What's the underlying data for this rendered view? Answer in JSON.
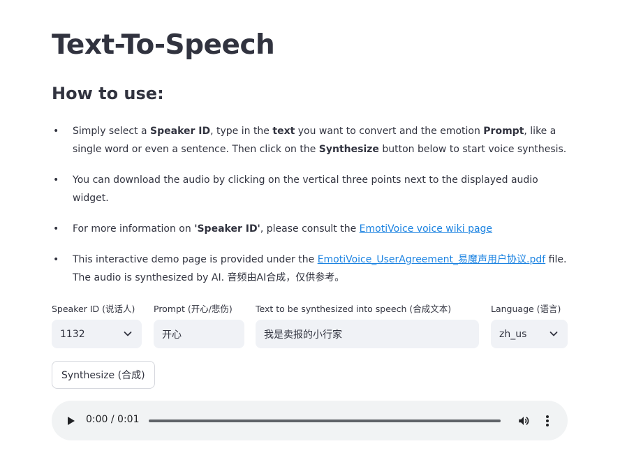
{
  "page": {
    "title": "Text-To-Speech",
    "subtitle": "How to use:"
  },
  "instructions": [
    {
      "a": "Simply select a ",
      "b1": "Speaker ID",
      "c": ", type in the ",
      "b2": "text",
      "d": " you want to convert and the emotion ",
      "b3": "Prompt",
      "e": ", like a single word or even a sentence. Then click on the ",
      "b4": "Synthesize",
      "f": " button below to start voice synthesis."
    },
    {
      "a": "You can download the audio by clicking on the vertical three points next to the displayed audio widget."
    },
    {
      "a": "For more information on ",
      "b1": "'Speaker ID'",
      "c": ", please consult the ",
      "link": "EmotiVoice voice wiki page"
    },
    {
      "a": "This interactive demo page is provided under the ",
      "link": "EmotiVoice_UserAgreement_易魔声用户协议.pdf",
      "c": " file. The audio is synthesized by AI. 音频由AI合成，仅供参考。"
    }
  ],
  "form": {
    "speaker": {
      "label": "Speaker ID (说话人)",
      "value": "1132"
    },
    "prompt": {
      "label": "Prompt (开心/悲伤)",
      "value": "开心"
    },
    "text": {
      "label": "Text to be synthesized into speech (合成文本)",
      "value": "我是卖报的小行家"
    },
    "language": {
      "label": "Language (语言)",
      "value": "zh_us"
    }
  },
  "synthesize_button": "Synthesize (合成)",
  "audio": {
    "time": "0:00 / 0:01",
    "progress": 0
  },
  "icons": {
    "select": "chevron-down-icon",
    "play": "play-icon",
    "volume": "volume-icon",
    "more": "more-vertical-icon"
  },
  "colors": {
    "text": "#31333f",
    "link": "#1c83e1",
    "field_bg": "#f0f2f6",
    "audio_bg": "#f1f3f4"
  }
}
